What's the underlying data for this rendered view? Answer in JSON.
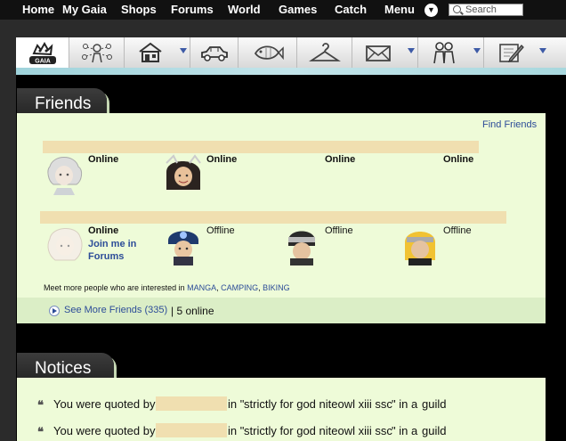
{
  "topnav": {
    "items": [
      "Home",
      "My Gaia",
      "Shops",
      "Forums",
      "World",
      "Games",
      "Catch",
      "Menu"
    ],
    "search_placeholder": "Search"
  },
  "tabs": [
    {
      "icon": "gaia-logo-icon"
    },
    {
      "icon": "people-network-icon"
    },
    {
      "icon": "house-icon",
      "dropdown": true
    },
    {
      "icon": "car-icon"
    },
    {
      "icon": "fish-icon"
    },
    {
      "icon": "hanger-icon"
    },
    {
      "icon": "envelope-icon",
      "dropdown": true
    },
    {
      "icon": "friends-icon",
      "dropdown": true
    },
    {
      "icon": "pencil-notepad-icon",
      "dropdown": true
    }
  ],
  "friends": {
    "title": "Friends",
    "find_friends": "Find Friends",
    "row1": [
      {
        "status": "Online"
      },
      {
        "status": "Online"
      },
      {
        "status": "Online"
      },
      {
        "status": "Online"
      }
    ],
    "row2": [
      {
        "status": "Online",
        "extra": "Join me in Forums"
      },
      {
        "status": "Offline"
      },
      {
        "status": "Offline"
      },
      {
        "status": "Offline"
      }
    ],
    "interests_prefix": "Meet more people who are interested in",
    "interests": [
      "MANGA",
      "CAMPING",
      "BIKING"
    ],
    "see_more": "See More Friends (335)",
    "online_count": "| 5 online"
  },
  "notices": {
    "title": "Notices",
    "items": [
      {
        "prefix": "You were quoted by",
        "mid": "in \"",
        "thread": "strictly for god niteowl xiii ssc",
        "suffix": "\" in a",
        "place": "guild"
      },
      {
        "prefix": "You were quoted by",
        "mid": "in \"",
        "thread": "strictly for god niteowl xiii ssc",
        "suffix": "\" in a",
        "place": "guild"
      }
    ]
  }
}
